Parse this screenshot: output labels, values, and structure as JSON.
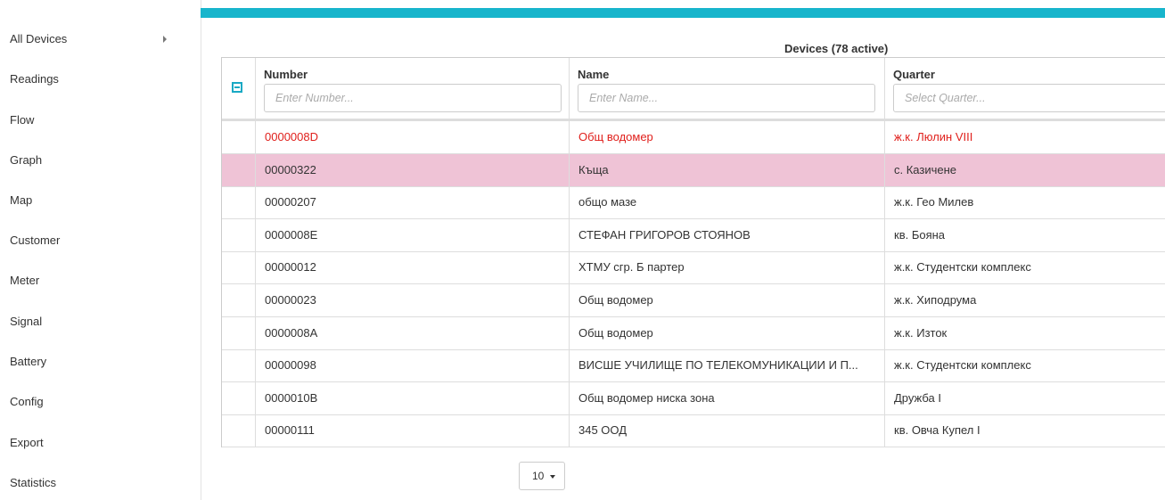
{
  "sidebar": {
    "items": [
      {
        "label": "All Devices"
      },
      {
        "label": "Readings"
      },
      {
        "label": "Flow"
      },
      {
        "label": "Graph"
      },
      {
        "label": "Map"
      },
      {
        "label": "Customer"
      },
      {
        "label": "Meter"
      },
      {
        "label": "Signal"
      },
      {
        "label": "Battery"
      },
      {
        "label": "Config"
      },
      {
        "label": "Export"
      },
      {
        "label": "Statistics"
      }
    ]
  },
  "colors": {
    "accent": "#18b5cc",
    "selected_row": "#efc3d6",
    "alert_text": "#e0201c"
  },
  "table": {
    "caption": "Devices (78 active)",
    "columns": [
      {
        "label": "Number",
        "placeholder": "Enter Number..."
      },
      {
        "label": "Name",
        "placeholder": "Enter Name..."
      },
      {
        "label": "Quarter",
        "placeholder": "Select Quarter..."
      }
    ],
    "rows": [
      {
        "number": "0000008D",
        "name": "Общ водомер",
        "quarter": "ж.к. Люлин VIII",
        "state": "alert"
      },
      {
        "number": "00000322",
        "name": "Къща",
        "quarter": "с. Казичене",
        "state": "selected"
      },
      {
        "number": "00000207",
        "name": "общо мазе",
        "quarter": "ж.к. Гео Милев",
        "state": ""
      },
      {
        "number": "0000008E",
        "name": "СТЕФАН ГРИГОРОВ СТОЯНОВ",
        "quarter": "кв. Бояна",
        "state": ""
      },
      {
        "number": "00000012",
        "name": "ХТМУ сгр. Б партер",
        "quarter": "ж.к. Студентски комплекс",
        "state": ""
      },
      {
        "number": "00000023",
        "name": "Общ водомер",
        "quarter": "ж.к. Хиподрума",
        "state": ""
      },
      {
        "number": "0000008A",
        "name": "Общ водомер",
        "quarter": "ж.к. Изток",
        "state": ""
      },
      {
        "number": "00000098",
        "name": "ВИСШЕ УЧИЛИЩЕ ПО ТЕЛЕКОМУНИКАЦИИ И П...",
        "quarter": "ж.к. Студентски комплекс",
        "state": ""
      },
      {
        "number": "0000010B",
        "name": "Общ водомер ниска зона",
        "quarter": "Дружба I",
        "state": ""
      },
      {
        "number": "00000111",
        "name": "345 ООД",
        "quarter": "кв. Овча Купел I",
        "state": ""
      }
    ]
  },
  "pagination": {
    "page_size": "10"
  }
}
